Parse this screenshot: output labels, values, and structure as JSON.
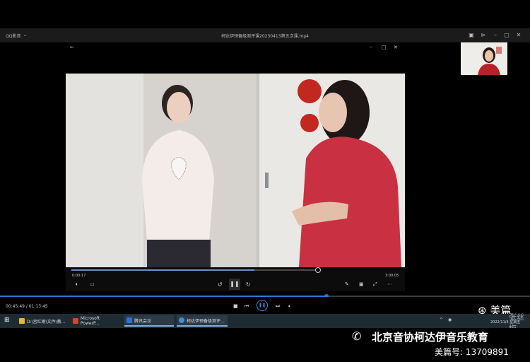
{
  "outer_player": {
    "app_name": "QQ影音",
    "file_title": "柯达伊预备级测评课20230413第五次课.mp4",
    "elapsed": "00:45:49",
    "total": "01:13:45",
    "progress_fraction": 0.616
  },
  "inner_player": {
    "elapsed": "0:00:17",
    "total": "3:00:05",
    "progress_fraction": 0.74
  },
  "taskbar": {
    "items": [
      {
        "label": "D:\\宫红雨\\文件\\教...",
        "color": "#e8b33b"
      },
      {
        "label": "Microsoft PowerP...",
        "color": "#d24726"
      },
      {
        "label": "腾讯会议",
        "color": "#2f6fdb"
      },
      {
        "label": "柯达伊预备级测评...",
        "color": "#3a8ee6"
      }
    ],
    "clock_date": "2022/11/4 星期五"
  },
  "watermark": {
    "badge": "美篇",
    "author": "张丝梅",
    "name": "北京音协柯达伊音乐教育",
    "meipian_id": "美篇号: 13709891"
  },
  "colors": {
    "accent": "#2e77d8",
    "taskbar": "#1f2b33"
  }
}
